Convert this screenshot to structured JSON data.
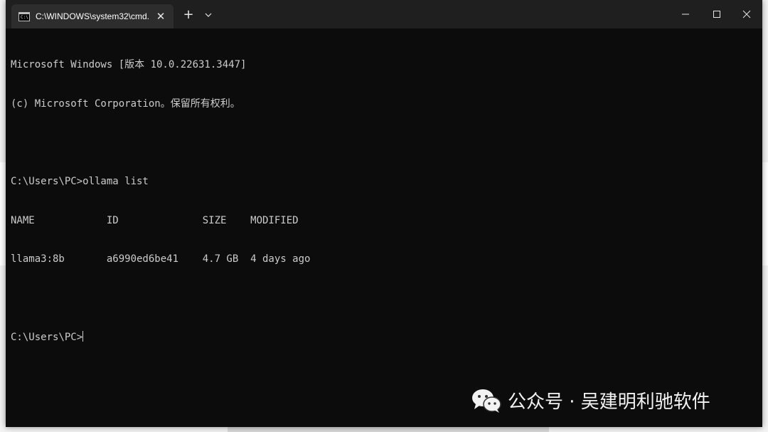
{
  "window": {
    "tab_title": "C:\\WINDOWS\\system32\\cmd.",
    "tab_icon_text": "C:\\",
    "close_tab_glyph": "✕",
    "new_tab_glyph": "+",
    "icons": {
      "tab": "console-icon",
      "new_tab": "plus-icon",
      "dropdown": "chevron-down-icon",
      "minimize": "minimize-icon",
      "maximize": "maximize-icon",
      "close": "close-icon"
    }
  },
  "console": {
    "lines": [
      "Microsoft Windows [版本 10.0.22631.3447]",
      "(c) Microsoft Corporation。保留所有权利。",
      "",
      "C:\\Users\\PC>ollama list",
      "NAME            ID              SIZE    MODIFIED",
      "llama3:8b       a6990ed6be41    4.7 GB  4 days ago",
      "",
      "C:\\Users\\PC>"
    ]
  },
  "watermark": {
    "text": "公众号 · 吴建明利驰软件",
    "icon": "wechat-icon"
  },
  "colors": {
    "console_bg": "#0c0c0c",
    "console_fg": "#cccccc",
    "titlebar_bg": "#1f1f1f",
    "tab_bg": "#2d2d2d"
  }
}
